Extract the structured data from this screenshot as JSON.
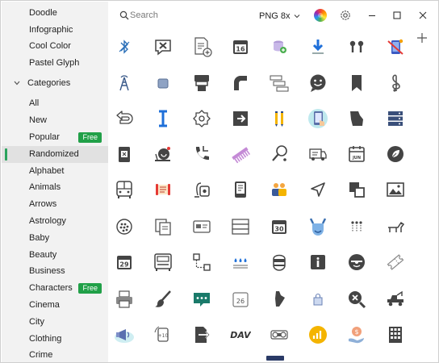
{
  "sidebar": {
    "top_items": [
      {
        "label": "Doodle"
      },
      {
        "label": "Infographic"
      },
      {
        "label": "Cool Color"
      },
      {
        "label": "Pastel Glyph"
      }
    ],
    "categories_header": "Categories",
    "categories": [
      {
        "label": "All"
      },
      {
        "label": "New"
      },
      {
        "label": "Popular",
        "badge": "Free"
      },
      {
        "label": "Randomized",
        "selected": true
      },
      {
        "label": "Alphabet"
      },
      {
        "label": "Animals"
      },
      {
        "label": "Arrows"
      },
      {
        "label": "Astrology"
      },
      {
        "label": "Baby"
      },
      {
        "label": "Beauty"
      },
      {
        "label": "Business"
      },
      {
        "label": "Characters",
        "badge": "Free"
      },
      {
        "label": "Cinema"
      },
      {
        "label": "City"
      },
      {
        "label": "Clothing"
      },
      {
        "label": "Crime"
      }
    ]
  },
  "toolbar": {
    "search_placeholder": "Search",
    "format_label": "PNG 8x"
  },
  "colors": {
    "accent_green": "#21a048",
    "icon_gray": "#4a4a4a",
    "icon_blue": "#2a6fb8"
  },
  "icon_rows": [
    [
      "bluetooth-off-icon",
      "tools-chat-icon",
      "add-document-icon",
      "calendar-16-icon",
      "database-add-icon",
      "download-arrow-icon",
      "bollards-icon",
      "no-cellphone-icon"
    ],
    [
      "signal-tower-icon",
      "rounded-square-icon",
      "ticket-machine-icon",
      "bend-pipe-icon",
      "steps-list-icon",
      "smiley-chat-icon",
      "bookmark-icon",
      "treble-clef-icon"
    ],
    [
      "undo-arrow-icon",
      "text-cursor-icon",
      "flower-badge-icon",
      "exit-door-icon",
      "pencils-icon",
      "tablet-touch-icon",
      "georgia-map-icon",
      "server-rack-icon"
    ],
    [
      "card-slot-icon",
      "snail-icon",
      "phone-callback-icon",
      "comb-icon",
      "racket-icon",
      "delivery-van-icon",
      "calendar-june-icon",
      "leaf-circle-icon"
    ],
    [
      "bus-front-icon",
      "scroll-icon",
      "vacuum-cleaner-icon",
      "ereader-icon",
      "team-icon",
      "navigation-arrow-icon",
      "overlap-squares-icon",
      "image-frame-icon"
    ],
    [
      "blackberry-icon",
      "copy-pages-icon",
      "card-icon",
      "drawers-icon",
      "calendar-30-icon",
      "viking-icon",
      "dot-pattern-icon",
      "dog-icon"
    ],
    [
      "calendar-29-icon",
      "truck-front-icon",
      "workflow-icon",
      "rain-drops-icon",
      "bandit-icon",
      "info-icon",
      "cool-face-icon",
      "ticket-outline-icon"
    ],
    [
      "printer-icon",
      "paint-brush-icon",
      "message-dots-icon",
      "calendar-26-icon",
      "maine-map-icon",
      "shopping-bag-icon",
      "no-magnify-icon",
      "tow-truck-icon"
    ],
    [
      "megaphone-cloud-icon",
      "rotate-phone-icon",
      "file-export-icon",
      "dav-text-icon",
      "car-parts-icon",
      "growth-chart-icon",
      "money-hand-icon",
      "building-grid-icon"
    ]
  ]
}
